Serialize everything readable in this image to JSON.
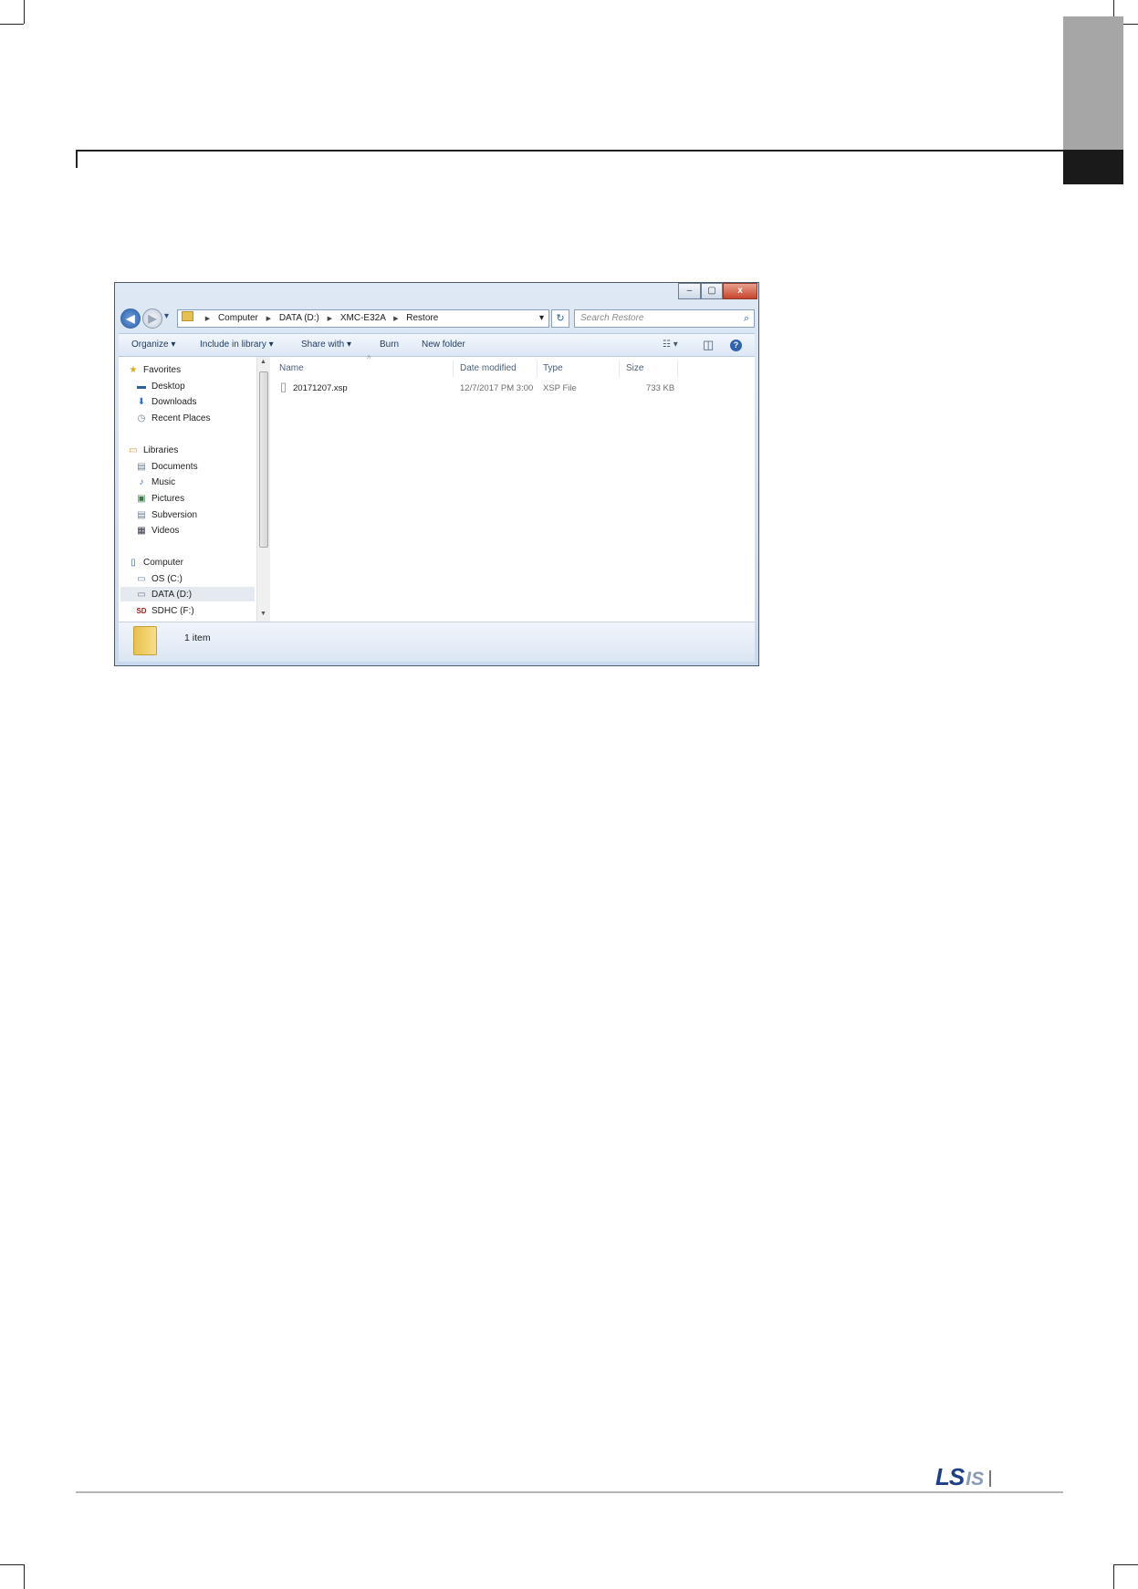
{
  "window": {
    "controls": {
      "minimize": "‒",
      "maximize": "▢",
      "close": "x"
    },
    "nav": {
      "back": "◀",
      "forward": "▶",
      "dropdown": "▾"
    },
    "address": {
      "crumbs": [
        "Computer",
        "DATA (D:)",
        "XMC-E32A",
        "Restore"
      ],
      "dropdown": "▾",
      "refresh": "↻"
    },
    "search": {
      "placeholder": "Search Restore",
      "icon": "⌕"
    },
    "toolbar": {
      "organize": "Organize ▾",
      "include": "Include in library ▾",
      "share": "Share with ▾",
      "burn": "Burn",
      "new_folder": "New folder",
      "view_icon": "☷ ▾",
      "pane_icon": "◫",
      "help_icon": "?"
    },
    "navpane": {
      "favorites": {
        "label": "Favorites",
        "icon": "★"
      },
      "desktop": {
        "label": "Desktop",
        "icon": "▬"
      },
      "downloads": {
        "label": "Downloads",
        "icon": "⬇"
      },
      "recent": {
        "label": "Recent Places",
        "icon": "◷"
      },
      "libraries": {
        "label": "Libraries",
        "icon": "▭"
      },
      "documents": {
        "label": "Documents",
        "icon": "▤"
      },
      "music": {
        "label": "Music",
        "icon": "♪"
      },
      "pictures": {
        "label": "Pictures",
        "icon": "▣"
      },
      "subversion": {
        "label": "Subversion",
        "icon": "▤"
      },
      "videos": {
        "label": "Videos",
        "icon": "▦"
      },
      "computer": {
        "label": "Computer",
        "icon": "▯"
      },
      "osc": {
        "label": "OS (C:)",
        "icon": "▭"
      },
      "datad": {
        "label": "DATA (D:)",
        "icon": "▭"
      },
      "sdhc": {
        "label": "SDHC (F:)",
        "icon": "SD"
      },
      "scroll_up": "▲",
      "scroll_down": "▼"
    },
    "columns": {
      "name": "Name",
      "date": "Date modified",
      "type": "Type",
      "size": "Size",
      "sort": "˄"
    },
    "files": [
      {
        "name": "20171207.xsp",
        "date": "12/7/2017 PM 3:00",
        "type": "XSP File",
        "size": "733 KB",
        "icon": "▯"
      }
    ],
    "status": "1 item"
  },
  "footer": {
    "logo_ls": "LS",
    "logo_is": "IS"
  },
  "colors": {
    "brand": "#1c3f86",
    "tab_grey": "#a6a6a6",
    "tab_black": "#1a1a1a"
  }
}
